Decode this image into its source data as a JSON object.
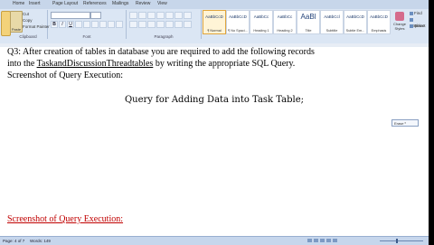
{
  "tabs": [
    "Home",
    "Insert",
    "Page Layout",
    "References",
    "Mailings",
    "Review",
    "View"
  ],
  "clipboard": {
    "paste_label": "Paste",
    "cut_label": "Cut",
    "copy_label": "Copy",
    "format_painter_label": "Format Painter",
    "group_label": "Clipboard"
  },
  "font_group": {
    "group_label": "Font",
    "bold": "B",
    "italic": "I",
    "underline": "U"
  },
  "paragraph_group": {
    "group_label": "Paragraph"
  },
  "styles": {
    "group_label": "Styles",
    "items": [
      {
        "sample": "AaBbCcD",
        "name": "¶ Normal",
        "selected": true,
        "big": false
      },
      {
        "sample": "AaBbCcD",
        "name": "¶ No Spaci...",
        "selected": false,
        "big": false
      },
      {
        "sample": "AaBbCc",
        "name": "Heading 1",
        "selected": false,
        "big": false
      },
      {
        "sample": "AaBbCc",
        "name": "Heading 2",
        "selected": false,
        "big": false
      },
      {
        "sample": "AaBl",
        "name": "Title",
        "selected": false,
        "big": true
      },
      {
        "sample": "AaBbCcl",
        "name": "Subtitle",
        "selected": false,
        "big": false
      },
      {
        "sample": "AaBbCcD",
        "name": "Subtle Em...",
        "selected": false,
        "big": false
      },
      {
        "sample": "AaBbCcD",
        "name": "Emphasis",
        "selected": false,
        "big": false
      }
    ],
    "change_styles_label": "Change Styles"
  },
  "editing": {
    "find": "Find",
    "replace": "Replace",
    "select": "Select"
  },
  "document": {
    "line1": "Q3: After creation of tables in database you are required to add the following records",
    "line2_prefix": "into the ",
    "line2_link": "TaskandDiscussionThreadtables",
    "line2_suffix": " by writing the appropriate SQL Query.",
    "line3": "Screenshot of Query Execution:",
    "centered_line": "Query for Adding Data into Task Table;",
    "red_heading": "Screenshot of Query Execution:"
  },
  "tooltip": "Erase ⁰",
  "status": {
    "page": "Page: 4 of 7",
    "words": "Words: 149"
  },
  "colors": {
    "ribbon": "#dbe6f4",
    "red_heading": "#c00000",
    "style_selected": "#fff4d6"
  }
}
